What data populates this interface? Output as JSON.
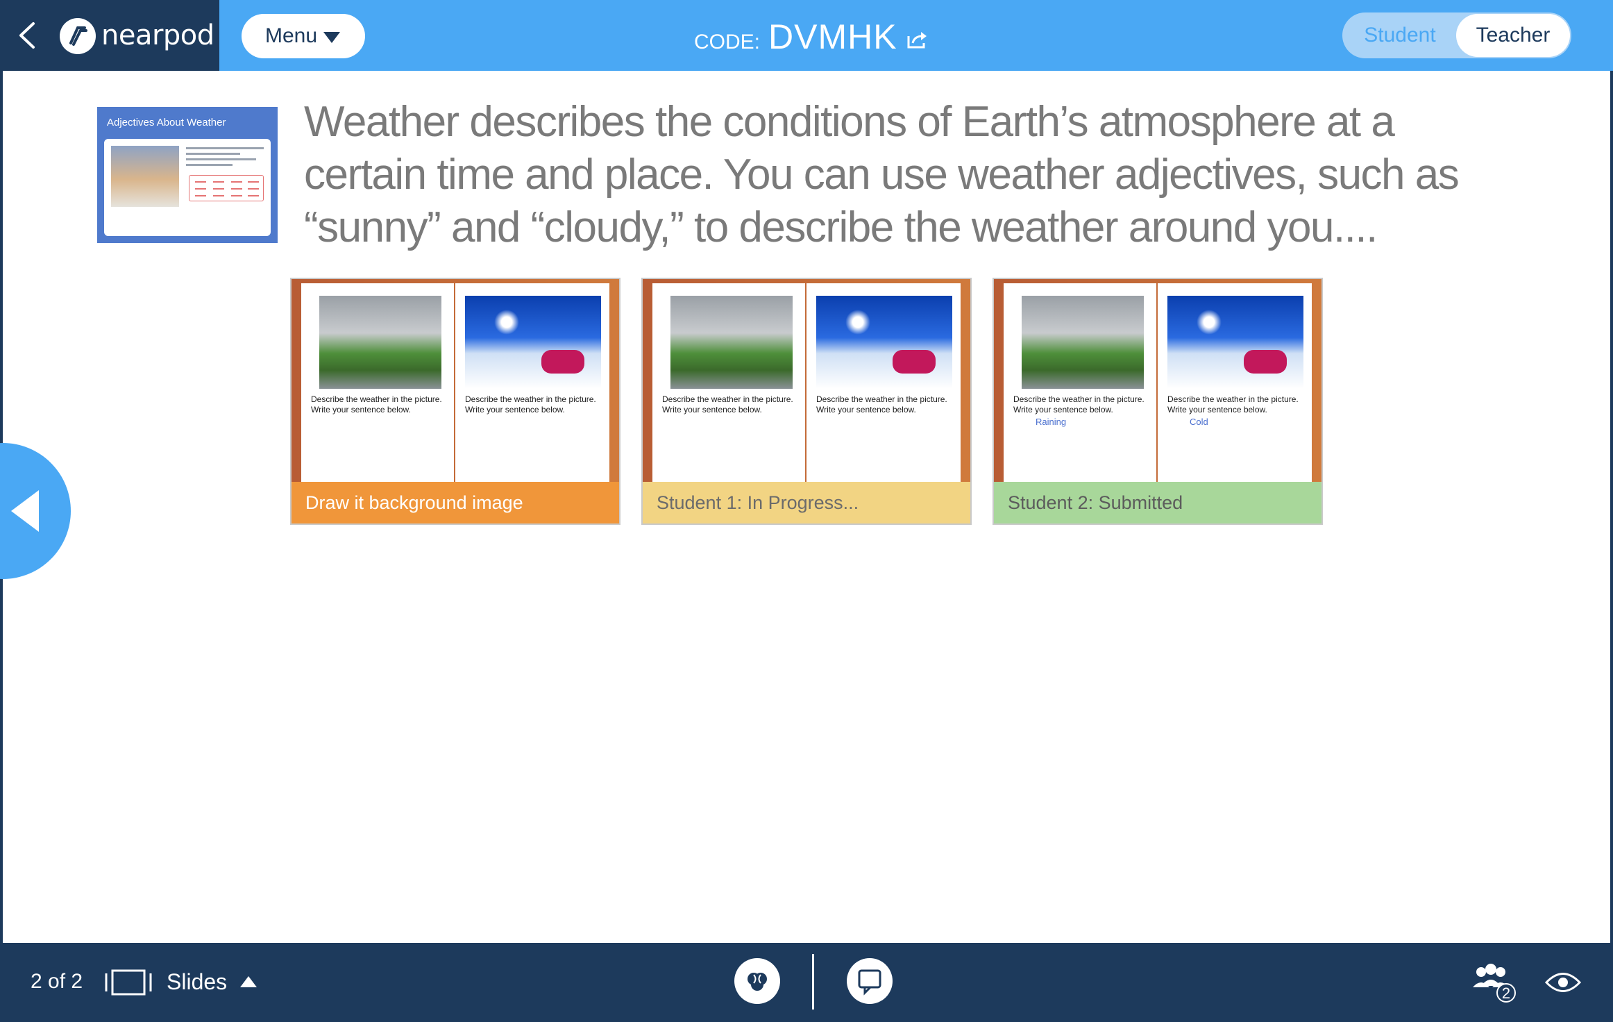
{
  "app": {
    "logo_text": "nearpod"
  },
  "header": {
    "menu_label": "Menu",
    "code_label": "CODE:",
    "code_value": "DVMHK",
    "toggle": {
      "student_label": "Student",
      "teacher_label": "Teacher",
      "selected": "Teacher"
    }
  },
  "slide": {
    "thumbnail": {
      "title": "Adjectives About Weather"
    },
    "headline": "Weather describes the conditions of Earth’s atmosphere at a certain time and place. You can use weather adjectives, such as “sunny” and “cloudy,” to describe the weather around you...."
  },
  "cards": [
    {
      "label": "Draw it background image",
      "prompt_left": "Describe the weather in the picture. Write your sentence below.",
      "prompt_right": "Describe the weather in the picture. Write your sentence below.",
      "answer_left": "",
      "answer_right": ""
    },
    {
      "label": "Student 1: In Progress...",
      "prompt_left": "Describe the weather in the picture. Write your sentence below.",
      "prompt_right": "Describe the weather in the picture. Write your sentence below.",
      "answer_left": "",
      "answer_right": ""
    },
    {
      "label": "Student 2: Submitted",
      "prompt_left": "Describe the weather in the picture. Write your sentence below.",
      "prompt_right": "Describe the weather in the picture. Write your sentence below.",
      "answer_left": "Raining",
      "answer_right": "Cold"
    }
  ],
  "footer": {
    "page_count": "2 of 2",
    "slides_label": "Slides",
    "participants_count": "2"
  },
  "colors": {
    "header_blue": "#4aa8f4",
    "navy": "#1d3a5c",
    "orange": "#f0963a",
    "yellow": "#f2d483",
    "green": "#a8d79a"
  },
  "icons": [
    "back-icon",
    "nearpod-logo-icon",
    "chevron-down-icon",
    "share-icon",
    "previous-slide-icon",
    "slides-icon",
    "brain-icon",
    "chat-icon",
    "participants-icon",
    "eye-icon"
  ]
}
